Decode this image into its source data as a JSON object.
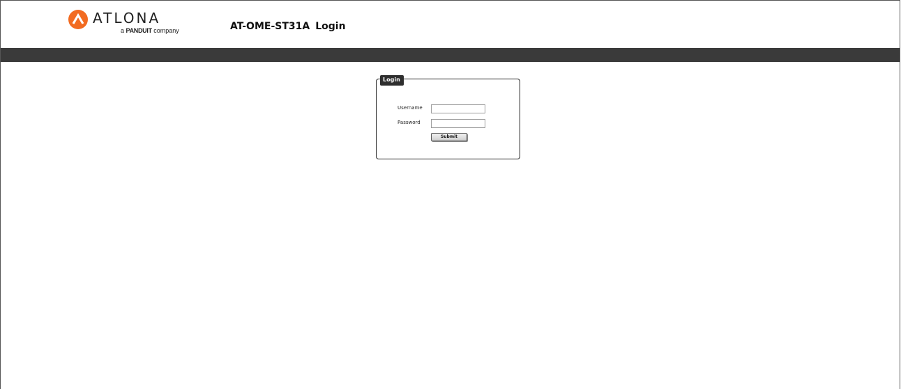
{
  "brand": {
    "logo_word": "ATLONA",
    "logo_tag_prefix": "a",
    "logo_tag_brand": "PANDUIT",
    "logo_tag_suffix": "company",
    "accent_color": "#f26b21"
  },
  "header": {
    "model": "AT-OME-ST31A",
    "title": "Login"
  },
  "login_form": {
    "legend": "Login",
    "username_label": "Username",
    "username_value": "",
    "password_label": "Password",
    "password_value": "",
    "submit_label": "Submit"
  },
  "colors": {
    "navbar": "#3a3a3a",
    "legend_bg": "#2e2e2e"
  }
}
